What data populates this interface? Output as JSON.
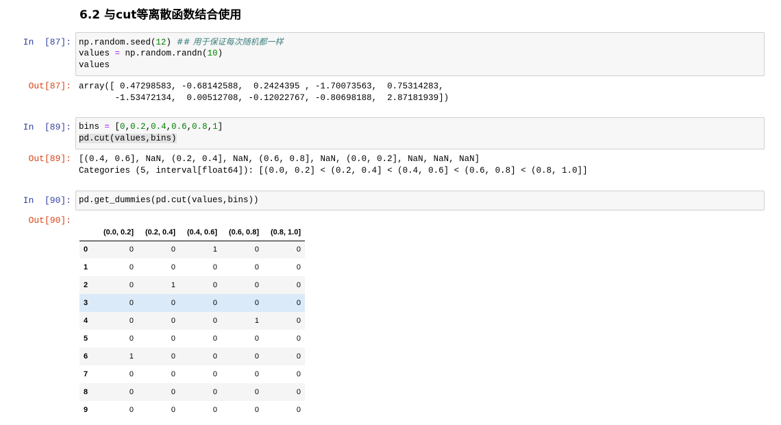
{
  "heading": "6.2 与cut等离散函数结合使用",
  "cells": {
    "c87": {
      "in_prompt": "In  [87]:",
      "out_prompt": "Out[87]:",
      "line1_code": "np.random.seed(",
      "line1_num": "12",
      "line1_close": ")",
      "line1_comment": "## 用于保证每次随机都一样",
      "line2_a": "values ",
      "line2_op": "=",
      "line2_b": " np.random.randn(",
      "line2_num": "10",
      "line2_close": ")",
      "line3": "values",
      "output_line1": "array([ 0.47298583, -0.68142588,  0.2424395 , -1.70073563,  0.75314283,",
      "output_line2": "       -1.53472134,  0.00512708, -0.12022767, -0.80698188,  2.87181939])"
    },
    "c89": {
      "in_prompt": "In  [89]:",
      "out_prompt": "Out[89]:",
      "line1_a": "bins ",
      "line1_op": "=",
      "line1_open": " [",
      "line1_n0": "0",
      "line1_n1": "0.2",
      "line1_n2": "0.4",
      "line1_n3": "0.6",
      "line1_n4": "0.8",
      "line1_n5": "1",
      "line1_close": "]",
      "comma": ",",
      "line2": "pd.cut(values,bins)",
      "output_line1": "[(0.4, 0.6], NaN, (0.2, 0.4], NaN, (0.6, 0.8], NaN, (0.0, 0.2], NaN, NaN, NaN]",
      "output_line2": "Categories (5, interval[float64]): [(0.0, 0.2] < (0.2, 0.4] < (0.4, 0.6] < (0.6, 0.8] < (0.8, 1.0]]"
    },
    "c90": {
      "in_prompt": "In  [90]:",
      "out_prompt": "Out[90]:",
      "line1": "pd.get_dummies(pd.cut(values,bins))",
      "table": {
        "columns": [
          "(0.0, 0.2]",
          "(0.2, 0.4]",
          "(0.4, 0.6]",
          "(0.6, 0.8]",
          "(0.8, 1.0]"
        ],
        "rows": [
          {
            "index": "0",
            "values": [
              "0",
              "0",
              "1",
              "0",
              "0"
            ]
          },
          {
            "index": "1",
            "values": [
              "0",
              "0",
              "0",
              "0",
              "0"
            ]
          },
          {
            "index": "2",
            "values": [
              "0",
              "1",
              "0",
              "0",
              "0"
            ]
          },
          {
            "index": "3",
            "values": [
              "0",
              "0",
              "0",
              "0",
              "0"
            ]
          },
          {
            "index": "4",
            "values": [
              "0",
              "0",
              "0",
              "1",
              "0"
            ]
          },
          {
            "index": "5",
            "values": [
              "0",
              "0",
              "0",
              "0",
              "0"
            ]
          },
          {
            "index": "6",
            "values": [
              "1",
              "0",
              "0",
              "0",
              "0"
            ]
          },
          {
            "index": "7",
            "values": [
              "0",
              "0",
              "0",
              "0",
              "0"
            ]
          },
          {
            "index": "8",
            "values": [
              "0",
              "0",
              "0",
              "0",
              "0"
            ]
          },
          {
            "index": "9",
            "values": [
              "0",
              "0",
              "0",
              "0",
              "0"
            ]
          }
        ]
      }
    }
  },
  "colors": {
    "in_prompt": "#303f9f",
    "out_prompt": "#d84315",
    "number": "#008000",
    "operator": "#aa22ff",
    "comment": "#408080",
    "hover_row": "#dbeaf8"
  }
}
